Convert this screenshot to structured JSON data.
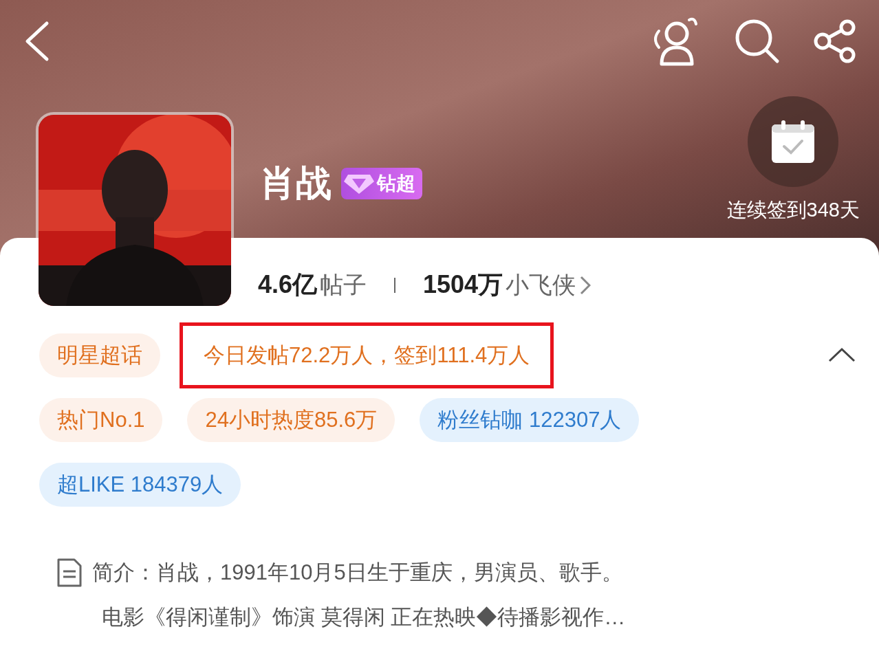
{
  "topic": {
    "name": "肖战",
    "badge": "钻超",
    "checkin": "连续签到348天"
  },
  "stats": [
    {
      "value": "4.6亿",
      "label": "帖子"
    },
    {
      "value": "1504万",
      "label": "小飞侠"
    }
  ],
  "tags": [
    {
      "kind": "orange",
      "text": "明星超话",
      "highlighted": false
    },
    {
      "kind": "plain",
      "text": "今日发帖72.2万人，签到111.4万人",
      "highlighted": true
    },
    {
      "kind": "orange",
      "text": "热门No.1",
      "highlighted": false
    },
    {
      "kind": "orange",
      "text": "24小时热度85.6万",
      "highlighted": false
    },
    {
      "kind": "blue",
      "text": "粉丝钻咖 122307人",
      "highlighted": false
    },
    {
      "kind": "blue",
      "text": "超LIKE 184379人",
      "highlighted": false
    }
  ],
  "tags_expanded": true,
  "intro": [
    "简介：肖战，1991年10月5日生于重庆，男演员、歌手。",
    "电影《得闲谨制》饰演 莫得闲 正在热映◆待播影视作…"
  ]
}
